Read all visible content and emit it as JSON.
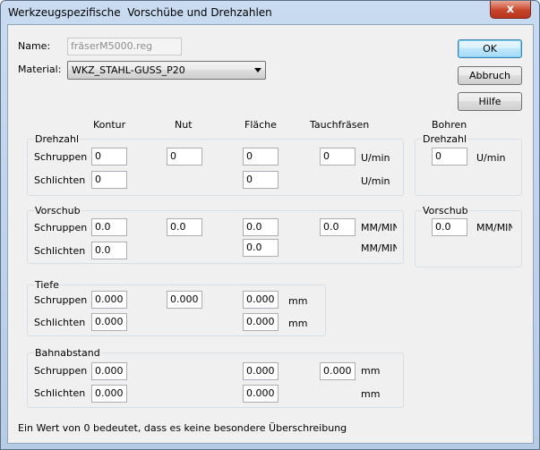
{
  "window": {
    "title": "Werkzeugspezifische  Vorschübe und Drehzahlen",
    "close": "x"
  },
  "name_label": "Name:",
  "name_value": "fräserM5000.reg",
  "material_label": "Material:",
  "material_value": "WKZ_STAHL-GUSS_P20",
  "buttons": {
    "ok": "OK",
    "abbruch": "Abbruch",
    "hilfe": "Hilfe"
  },
  "columns": {
    "kontur": "Kontur",
    "nut": "Nut",
    "flaeche": "Fläche",
    "tauchfraesen": "Tauchfräsen",
    "bohren": "Bohren"
  },
  "rows": {
    "schruppen": "Schruppen",
    "schlichten": "Schlichten"
  },
  "units": {
    "umin": "U/min",
    "mmmin": "MM/MIN",
    "mm": "mm"
  },
  "groups": {
    "drehzahl": "Drehzahl",
    "vorschub": "Vorschub",
    "tiefe": "Tiefe",
    "bahnabstand": "Bahnabstand"
  },
  "drehzahl": {
    "schruppen": {
      "kontur": "0",
      "nut": "0",
      "flaeche": "0",
      "tauch": "0"
    },
    "schlichten": {
      "kontur": "0",
      "flaeche": "0"
    }
  },
  "vorschub": {
    "schruppen": {
      "kontur": "0.0",
      "nut": "0.0",
      "flaeche": "0.0",
      "tauch": "0.0"
    },
    "schlichten": {
      "kontur": "0.0",
      "flaeche": "0.0"
    }
  },
  "tiefe": {
    "schruppen": {
      "kontur": "0.000",
      "nut": "0.000",
      "flaeche": "0.000"
    },
    "schlichten": {
      "kontur": "0.000",
      "flaeche": "0.000"
    }
  },
  "bahnabstand": {
    "schruppen": {
      "kontur": "0.000",
      "flaeche": "0.000",
      "tauch": "0.000"
    },
    "schlichten": {
      "kontur": "0.000",
      "flaeche": "0.000"
    }
  },
  "bohren": {
    "drehzahl": "0",
    "vorschub": "0.0"
  },
  "footer": "Ein Wert von 0 bedeutet, dass es keine besondere Überschreibung"
}
